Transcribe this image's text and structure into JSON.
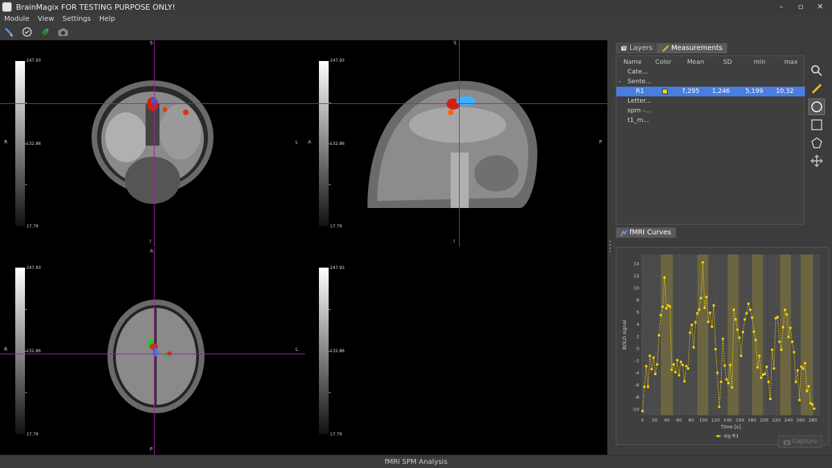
{
  "window": {
    "title": "BrainMagix FOR TESTING PURPOSE ONLY!",
    "minimize_glyph": "–",
    "maximize_glyph": "▫",
    "close_glyph": "✕"
  },
  "menu": [
    "Module",
    "View",
    "Settings",
    "Help"
  ],
  "toolbar_icons": [
    "brush-icon",
    "check-circle-icon",
    "leaf-icon",
    "camera-icon"
  ],
  "views": {
    "coronal": {
      "scale_max": "247.93",
      "scale_mid": "132.86",
      "scale_min": "17.79",
      "top": "S",
      "bottom": "I",
      "left": "R",
      "right": "L"
    },
    "sagittal": {
      "scale_max": "247.93",
      "scale_mid": "132.86",
      "scale_min": "17.79",
      "top": "S",
      "bottom": "I",
      "left": "A",
      "right": "P"
    },
    "axial": {
      "scale_max": "247.93",
      "scale_mid": "132.86",
      "scale_min": "17.79",
      "top": "A",
      "bottom": "P",
      "left": "R",
      "right": "L"
    },
    "empty": {
      "scale_max": "247.93",
      "scale_mid": "132.86",
      "scale_min": "17.79"
    }
  },
  "right_panel": {
    "tabs": [
      {
        "label": "Layers",
        "active": false
      },
      {
        "label": "Measurements",
        "active": true
      }
    ],
    "table_headers": [
      "Name",
      "Color",
      "Mean",
      "SD",
      "min",
      "max"
    ],
    "rows": [
      {
        "name": "Cate...",
        "indent": 1,
        "expander": ""
      },
      {
        "name": "Sente...",
        "indent": 1,
        "expander": "-"
      },
      {
        "name": "R1",
        "indent": 2,
        "expander": "",
        "selected": true,
        "color": "#ffd700",
        "mean": "7,295",
        "sd": "1,246",
        "min": "5,199",
        "max": "10,32"
      },
      {
        "name": "Letter...",
        "indent": 1,
        "expander": ""
      },
      {
        "name": "spm -...",
        "indent": 1,
        "expander": ""
      },
      {
        "name": "t1_m...",
        "indent": 1,
        "expander": ""
      }
    ],
    "tool_icons": [
      "zoom-icon",
      "ruler-icon",
      "ellipse-icon",
      "rectangle-icon",
      "polygon-icon",
      "move-icon"
    ],
    "curves_tab": "fMRI Curves",
    "capture_label": "Capture"
  },
  "chart_data": {
    "type": "line",
    "xlabel": "Time [s]",
    "ylabel": "BOLD signal",
    "xlim": [
      -2,
      292
    ],
    "ylim": [
      -11,
      15.5
    ],
    "xticks": [
      0,
      20,
      40,
      60,
      80,
      100,
      120,
      140,
      160,
      180,
      200,
      220,
      240,
      260,
      280
    ],
    "yticks": [
      -10,
      -8,
      -6,
      -4,
      -2,
      0,
      2,
      4,
      6,
      8,
      10,
      12,
      14
    ],
    "grid": true,
    "legend_position": "bottom-center",
    "blocks": [
      [
        30,
        50
      ],
      [
        90,
        108
      ],
      [
        140,
        158
      ],
      [
        180,
        198
      ],
      [
        226,
        244
      ],
      [
        260,
        280
      ]
    ],
    "series": [
      {
        "name": "sig R1",
        "color": "#ffd700",
        "x": [
          0,
          3,
          6,
          9,
          12,
          15,
          18,
          21,
          24,
          27,
          30,
          33,
          36,
          39,
          42,
          45,
          48,
          51,
          54,
          57,
          60,
          63,
          66,
          69,
          72,
          75,
          78,
          81,
          84,
          87,
          90,
          93,
          96,
          99,
          102,
          105,
          108,
          111,
          114,
          117,
          120,
          123,
          126,
          129,
          132,
          135,
          138,
          141,
          144,
          147,
          150,
          153,
          156,
          159,
          162,
          165,
          168,
          171,
          174,
          177,
          180,
          183,
          186,
          189,
          192,
          195,
          198,
          201,
          204,
          207,
          210,
          213,
          216,
          219,
          222,
          225,
          228,
          231,
          234,
          237,
          240,
          243,
          246,
          249,
          252,
          255,
          258,
          261,
          264,
          267,
          270,
          273,
          276,
          279,
          282
        ],
        "y": [
          -10.3,
          -6.3,
          -2.9,
          -6.3,
          -1.2,
          -3.4,
          -1.5,
          -4.2,
          -2.6,
          2.2,
          5.5,
          6.9,
          11.7,
          6.6,
          7.1,
          6.9,
          -3.5,
          -2.6,
          -3.9,
          -1.9,
          -4.4,
          -2.2,
          -2.7,
          -5.4,
          -2.9,
          -3.3,
          2.6,
          3.9,
          0.2,
          4.3,
          5.8,
          6.4,
          8.3,
          14.2,
          6.7,
          8.5,
          4.4,
          5.9,
          3.6,
          7.1,
          -0.1,
          -4.0,
          -9.6,
          -5.5,
          1.6,
          -2.8,
          -5.1,
          -5.7,
          -2.7,
          -6.4,
          6.4,
          4.8,
          3.1,
          1.8,
          -1.2,
          2.7,
          4.8,
          5.8,
          7.4,
          6.4,
          5.1,
          2.8,
          1.4,
          -3.1,
          -1.2,
          -4.8,
          -4.3,
          -4.2,
          -3.0,
          -5.5,
          -8.3,
          -0.2,
          -3.3,
          5.0,
          5.2,
          1.1,
          -0.2,
          3.5,
          6.4,
          5.6,
          1.9,
          3.4,
          1.1,
          -0.6,
          -5.5,
          -3.6,
          -8.5,
          -3.0,
          -3.3,
          -2.4,
          -7.0,
          -6.2,
          -9.0,
          -9.2,
          -9.9
        ]
      }
    ]
  },
  "status": "fMRI SPM Analysis"
}
